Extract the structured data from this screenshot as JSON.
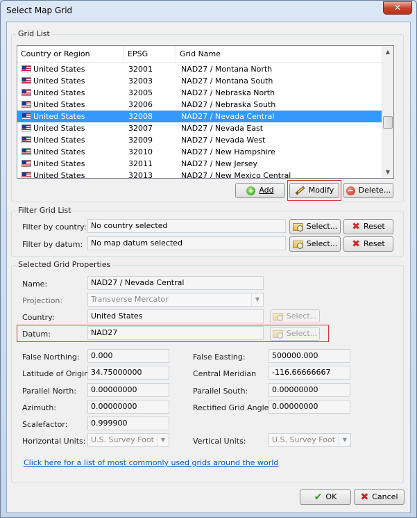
{
  "window": {
    "title": "Select Map Grid",
    "close_glyph": "✕"
  },
  "grid_list": {
    "group_label": "Grid List",
    "columns": [
      "Country or Region",
      "EPSG",
      "Grid Name"
    ],
    "rows": [
      {
        "country": "United States",
        "epsg": "32001",
        "name": "NAD27 / Montana North"
      },
      {
        "country": "United States",
        "epsg": "32003",
        "name": "NAD27 / Montana South"
      },
      {
        "country": "United States",
        "epsg": "32005",
        "name": "NAD27 / Nebraska North"
      },
      {
        "country": "United States",
        "epsg": "32006",
        "name": "NAD27 / Nebraska South"
      },
      {
        "country": "United States",
        "epsg": "32008",
        "name": "NAD27 / Nevada Central",
        "selected": true
      },
      {
        "country": "United States",
        "epsg": "32007",
        "name": "NAD27 / Nevada East"
      },
      {
        "country": "United States",
        "epsg": "32009",
        "name": "NAD27 / Nevada West"
      },
      {
        "country": "United States",
        "epsg": "32010",
        "name": "NAD27 / New Hampshire"
      },
      {
        "country": "United States",
        "epsg": "32011",
        "name": "NAD27 / New Jersey"
      },
      {
        "country": "United States",
        "epsg": "32013",
        "name": "NAD27 / New Mexico Central"
      }
    ],
    "buttons": {
      "add": "Add",
      "modify": "Modify",
      "delete": "Delete..."
    }
  },
  "filter": {
    "group_label": "Filter Grid List",
    "country_label": "Filter by country:",
    "country_value": "No country selected",
    "datum_label": "Filter by datum:",
    "datum_value": "No map datum selected",
    "select_label": "Select...",
    "reset_label": "Reset"
  },
  "props": {
    "group_label": "Selected Grid Properties",
    "name_label": "Name:",
    "name_value": "NAD27 / Nevada Central",
    "projection_label": "Projection:",
    "projection_value": "Transverse Mercator",
    "country_label": "Country:",
    "country_value": "United States",
    "datum_label": "Datum:",
    "datum_value": "NAD27",
    "select_label": "Select...",
    "false_northing_label": "False Northing:",
    "false_northing_value": "0.000",
    "false_easting_label": "False Easting:",
    "false_easting_value": "500000.000",
    "lat_origin_label": "Latitude of Origin",
    "lat_origin_value": "34.75000000",
    "central_meridian_label": "Central Meridian",
    "central_meridian_value": "-116.66666667",
    "parallel_north_label": "Parallel North:",
    "parallel_north_value": "0.00000000",
    "parallel_south_label": "Parallel South:",
    "parallel_south_value": "0.00000000",
    "azimuth_label": "Azimuth:",
    "azimuth_value": "0.00000000",
    "rect_angle_label": "Rectified Grid Angle:",
    "rect_angle_value": "0.00000000",
    "scalefactor_label": "Scalefactor:",
    "scalefactor_value": "0.999900",
    "h_units_label": "Horizontal Units:",
    "h_units_value": "U.S. Survey Foot",
    "v_units_label": "Vertical Units:",
    "v_units_value": "U.S. Survey Foot"
  },
  "link_text": "Click here for a list of most commonly used grids around the world",
  "footer": {
    "ok": "OK",
    "cancel": "Cancel"
  }
}
